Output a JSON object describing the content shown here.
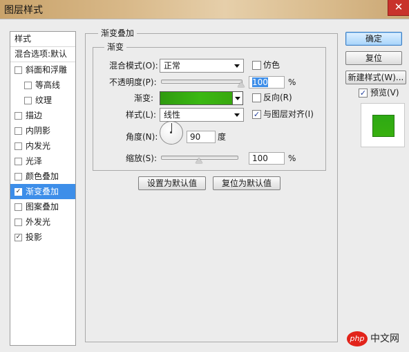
{
  "window": {
    "title": "图层样式",
    "close_glyph": "✕"
  },
  "styles_panel": {
    "header": "样式",
    "blend_options": "混合选项:默认",
    "items": [
      {
        "label": "斜面和浮雕",
        "checked": false,
        "sub": false,
        "selected": false
      },
      {
        "label": "等高线",
        "checked": false,
        "sub": true,
        "selected": false
      },
      {
        "label": "纹理",
        "checked": false,
        "sub": true,
        "selected": false
      },
      {
        "label": "描边",
        "checked": false,
        "sub": false,
        "selected": false
      },
      {
        "label": "内阴影",
        "checked": false,
        "sub": false,
        "selected": false
      },
      {
        "label": "内发光",
        "checked": false,
        "sub": false,
        "selected": false
      },
      {
        "label": "光泽",
        "checked": false,
        "sub": false,
        "selected": false
      },
      {
        "label": "颜色叠加",
        "checked": false,
        "sub": false,
        "selected": false
      },
      {
        "label": "渐变叠加",
        "checked": true,
        "sub": false,
        "selected": true
      },
      {
        "label": "图案叠加",
        "checked": false,
        "sub": false,
        "selected": false
      },
      {
        "label": "外发光",
        "checked": false,
        "sub": false,
        "selected": false
      },
      {
        "label": "投影",
        "checked": true,
        "sub": false,
        "selected": false
      }
    ]
  },
  "gradient_overlay": {
    "section_title": "渐变叠加",
    "group_title": "渐变",
    "blend_mode_label": "混合模式(O):",
    "blend_mode_value": "正常",
    "dither_label": "仿色",
    "dither_checked": false,
    "opacity_label": "不透明度(P):",
    "opacity_value": "100",
    "opacity_unit": "%",
    "opacity_level": 1.0,
    "gradient_label": "渐变:",
    "reverse_label": "反向(R)",
    "reverse_checked": false,
    "style_label": "样式(L):",
    "style_value": "线性",
    "align_label": "与图层对齐(I)",
    "align_checked": true,
    "angle_label": "角度(N):",
    "angle_value": "90",
    "angle_unit": "度",
    "scale_label": "缩放(S):",
    "scale_value": "100",
    "scale_unit": "%",
    "scale_level": 0.5,
    "set_default_button": "设置为默认值",
    "reset_default_button": "复位为默认值"
  },
  "right_panel": {
    "ok_button": "确定",
    "reset_button": "复位",
    "new_style_button": "新建样式(W)...",
    "preview_label": "预览(V)",
    "preview_checked": true
  },
  "watermark": {
    "logo_text": "php",
    "site_text": "中文网"
  },
  "colors": {
    "accent_selection": "#3d8ee9",
    "gradient_green": "#3ab812",
    "close_red": "#c8322b"
  }
}
